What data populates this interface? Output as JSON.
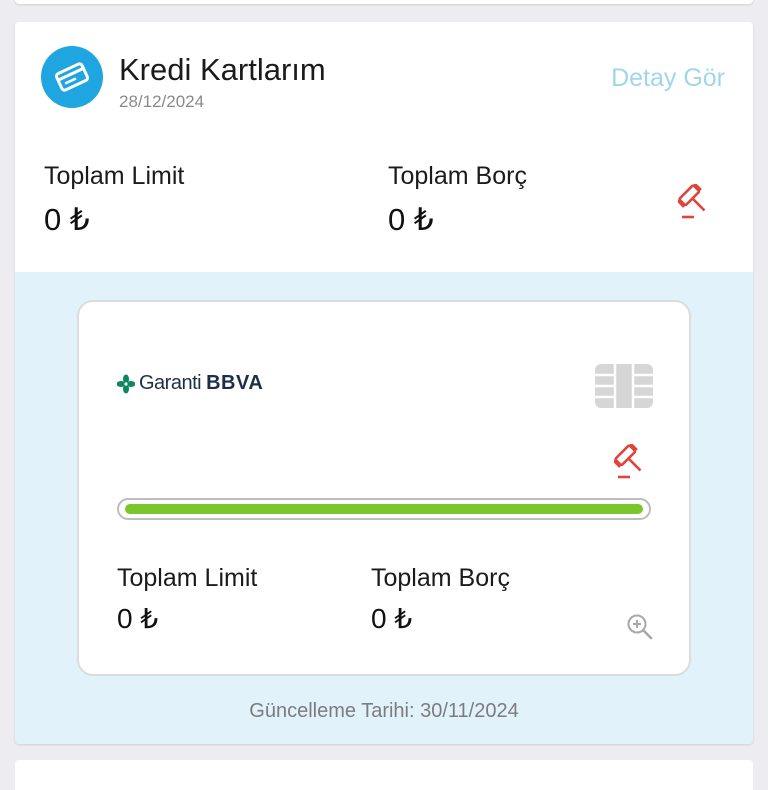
{
  "header": {
    "icon": "credit-card-icon",
    "title": "Kredi Kartlarım",
    "date": "28/12/2024",
    "detail_link": "Detay Gör"
  },
  "summary": {
    "limit_label": "Toplam Limit",
    "limit_value": "0 ₺",
    "debt_label": "Toplam Borç",
    "debt_value": "0 ₺",
    "action_icon": "hammer-icon"
  },
  "card": {
    "bank_name": "Garanti",
    "bank_suffix": "BBVA",
    "chip_icon": "card-chip-icon",
    "action_icon": "hammer-icon",
    "usage_fraction": 1.0,
    "limit_label": "Toplam Limit",
    "limit_value": "0 ₺",
    "debt_label": "Toplam Borç",
    "debt_value": "0 ₺",
    "zoom_icon": "zoom-in-icon"
  },
  "footer": {
    "update_text": "Güncelleme Tarihi: 30/11/2024"
  },
  "colors": {
    "accent_blue": "#1fa6e0",
    "link_blue": "#9fd6ee",
    "hammer_red": "#e0443c",
    "progress_green": "#7cc62d",
    "area_blue": "#e2f2fb"
  }
}
